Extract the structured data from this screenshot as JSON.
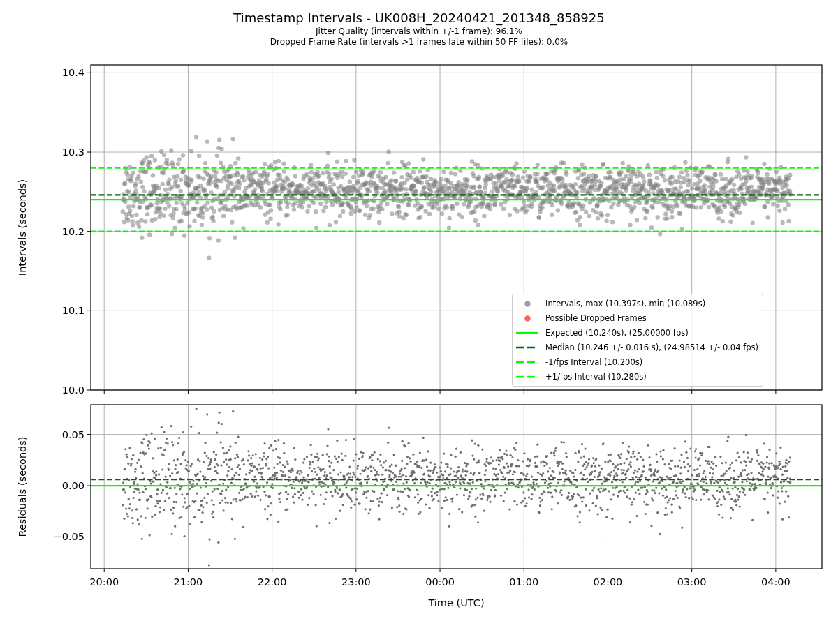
{
  "figure": {
    "title": "Timestamp Intervals - UK008H_20240421_201348_858925",
    "subtitles": [
      "Jitter Quality (intervals within +/-1 frame): 96.1%",
      "Dropped Frame Rate (intervals >1 frames late within 50 FF files): 0.0%"
    ]
  },
  "charts": [
    {
      "legend": [
        {
          "label": "Intervals, max (10.397s), min (10.089s)",
          "color": "#a0a0a0",
          "kind": "dot"
        },
        {
          "label": "Possible Dropped Frames",
          "color": "#ff6060",
          "kind": "dot"
        },
        {
          "label": "Expected (10.240s), (25.00000 fps)",
          "color": "#00ff00",
          "kind": "solid"
        },
        {
          "label": "Median (10.246 +/- 0.016 s), (24.98514 +/- 0.04 fps)",
          "color": "#006400",
          "kind": "dashed"
        },
        {
          "label": "-1/fps Interval (10.200s)",
          "color": "#00ff00",
          "kind": "dashed"
        },
        {
          "label": "+1/fps Interval (10.280s)",
          "color": "#00ff00",
          "kind": "dashed"
        }
      ],
      "chart_data": {
        "type": "scatter",
        "ylabel": "Intervals (seconds)",
        "categories": [
          null,
          null,
          null,
          null,
          null,
          null,
          null,
          null,
          null
        ],
        "ylim": [
          10.0,
          10.41
        ],
        "yticks": [
          {
            "value": 10.0,
            "label": "10.0"
          },
          {
            "value": 10.1,
            "label": "10.1"
          },
          {
            "value": 10.2,
            "label": "10.2"
          },
          {
            "value": 10.3,
            "label": "10.3"
          },
          {
            "value": 10.4,
            "label": "10.4"
          }
        ],
        "grid": true,
        "ref_lines": [
          {
            "axis": "y",
            "value": 10.24,
            "color": "#00ff00"
          },
          {
            "axis": "y",
            "value": 10.246,
            "color": "#006400"
          },
          {
            "axis": "y",
            "value": 10.2,
            "color": "#00ff00"
          },
          {
            "axis": "y",
            "value": 10.28,
            "color": "#00ff00"
          }
        ]
      }
    },
    {
      "chart_data": {
        "type": "scatter",
        "xlabel": "Time (UTC)",
        "ylabel": "Residuals (seconds)",
        "categories": [
          "20:00",
          "21:00",
          "22:00",
          "23:00",
          "00:00",
          "01:00",
          "02:00",
          "03:00",
          "04:00"
        ],
        "ylim": [
          -0.081,
          0.079
        ],
        "yticks": [
          {
            "value": -0.05,
            "label": "−0.05"
          },
          {
            "value": 0,
            "label": "0.00"
          },
          {
            "value": 0.05,
            "label": "0.05"
          }
        ],
        "grid": true,
        "ref_lines": [
          {
            "axis": "y",
            "value": 0,
            "color": "#00ff00"
          },
          {
            "axis": "y",
            "value": 0.006,
            "color": "#006400"
          }
        ]
      }
    }
  ]
}
